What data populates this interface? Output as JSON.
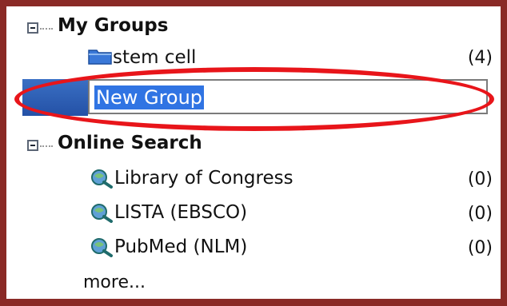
{
  "my_groups": {
    "title": "My Groups",
    "items": [
      {
        "label": "stem cell",
        "count": "(4)",
        "icon": "folder-icon"
      }
    ],
    "new_group_value": "New Group"
  },
  "online_search": {
    "title": "Online Search",
    "items": [
      {
        "label": "Library of Congress",
        "count": "(0)",
        "icon": "online-search-icon"
      },
      {
        "label": "LISTA (EBSCO)",
        "count": "(0)",
        "icon": "online-search-icon"
      },
      {
        "label": "PubMed (NLM)",
        "count": "(0)",
        "icon": "online-search-icon"
      }
    ],
    "more_label": "more..."
  },
  "colors": {
    "frame": "#8a2a26",
    "highlight_ellipse": "#e8151a",
    "selection": "#3074e3"
  }
}
